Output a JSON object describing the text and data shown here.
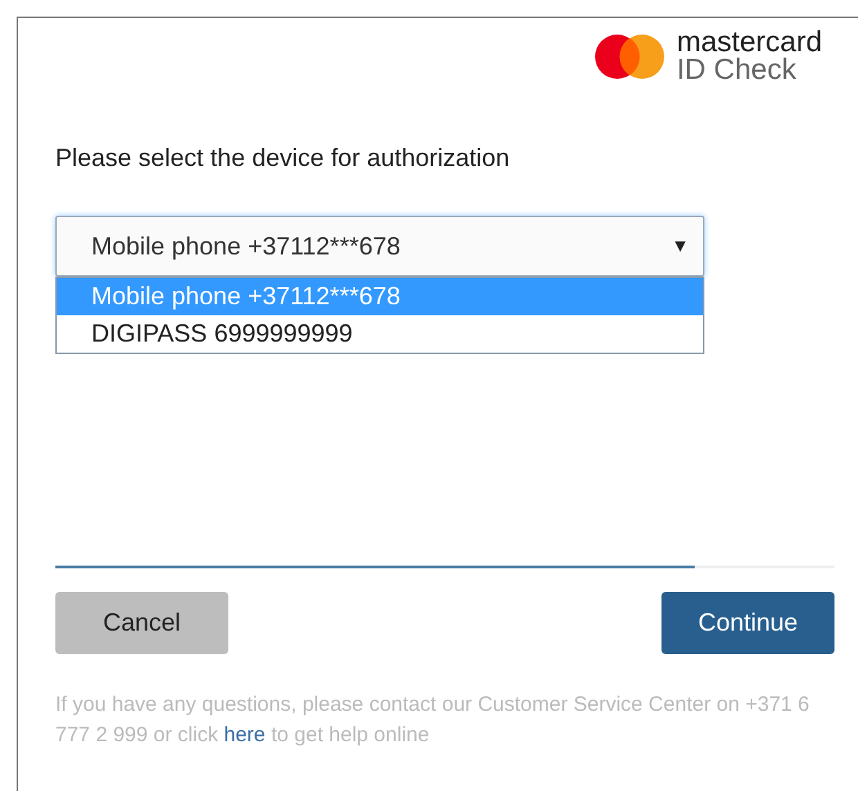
{
  "logo": {
    "brand": "mastercard",
    "product": "ID Check"
  },
  "prompt": "Please select the device for authorization",
  "device_select": {
    "value": "Mobile phone +37112***678",
    "caret": "▼",
    "options": [
      {
        "label": "Mobile phone +37112***678",
        "selected": true
      },
      {
        "label": "DIGIPASS 6999999999",
        "selected": false
      }
    ]
  },
  "progress": {
    "level": 0.82
  },
  "buttons": [
    {
      "label": "Cancel",
      "kind": "secondary"
    },
    {
      "label": "Continue",
      "kind": "primary"
    }
  ],
  "footer": {
    "before": "If you have any questions, please contact our Customer Service Center on +371 6 777 2 999 or click",
    "link": "here",
    "after": "to get help online"
  }
}
